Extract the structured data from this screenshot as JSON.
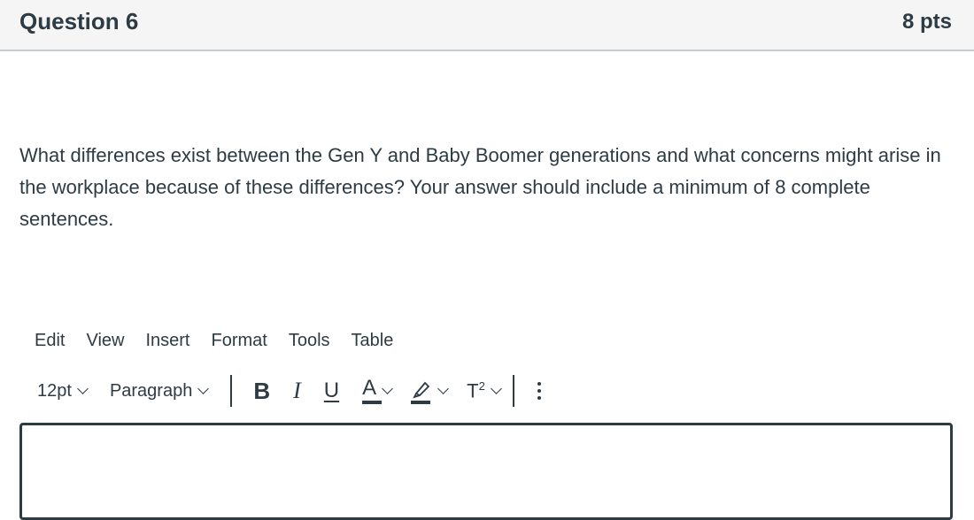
{
  "question": {
    "title": "Question 6",
    "points": "8 pts",
    "text": "What differences exist between the Gen Y and Baby Boomer generations and what concerns might arise in the workplace because of these differences? Your answer should include a minimum of 8 complete sentences."
  },
  "editor": {
    "menu": [
      "Edit",
      "View",
      "Insert",
      "Format",
      "Tools",
      "Table"
    ],
    "font_size": "12pt",
    "block_format": "Paragraph",
    "bold_label": "B",
    "italic_label": "I",
    "underline_label": "U",
    "text_color_label": "A",
    "superscript_label": "T",
    "superscript_mark": "2",
    "icons": [
      "chevron-down-icon",
      "highlighter-icon",
      "more-vertical-icon"
    ],
    "colors": {
      "text": "#2d3b45",
      "header_bg": "#f5f5f5",
      "border": "#c7cdd1"
    }
  }
}
